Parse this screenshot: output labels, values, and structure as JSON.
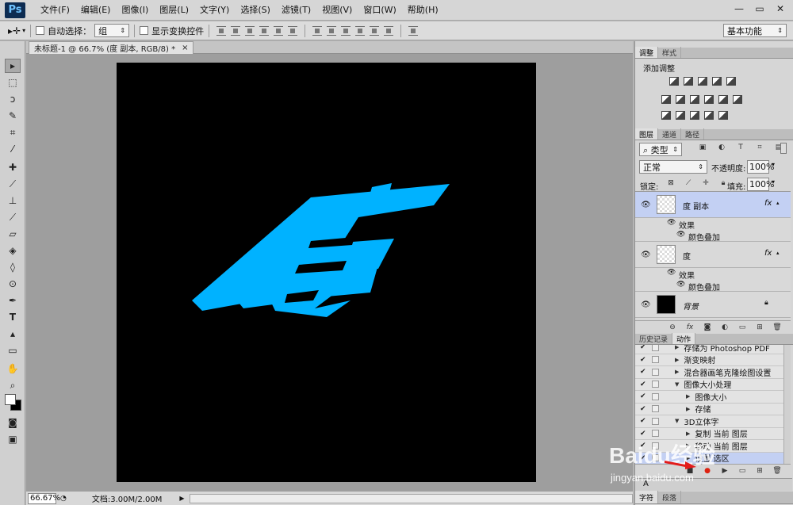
{
  "app": {
    "logo": "Ps"
  },
  "menu": [
    "文件(F)",
    "编辑(E)",
    "图像(I)",
    "图层(L)",
    "文字(Y)",
    "选择(S)",
    "滤镜(T)",
    "视图(V)",
    "窗口(W)",
    "帮助(H)"
  ],
  "window_controls": {
    "minimize": "—",
    "restore": "▭",
    "close": "✕"
  },
  "options": {
    "auto_select_label": "自动选择：",
    "auto_select_value": "组",
    "transform_controls_label": "显示变换控件",
    "workspace_preset": "基本功能"
  },
  "document": {
    "tab_title": "未标题-1 @ 66.7% (度 副本, RGB/8) *",
    "tab_close": "×",
    "canvas_color": "#000000",
    "artwork_text": "度",
    "artwork_color": "#00b2ff"
  },
  "status": {
    "zoom": "66.67%",
    "doc_size": "文档:3.00M/2.00M"
  },
  "panels": {
    "adjust_tabs": [
      "调整",
      "样式"
    ],
    "adjust_title": "添加调整",
    "layers_tabs": [
      "图层",
      "通道",
      "路径"
    ],
    "filter_kind": "类型",
    "blend_mode": "正常",
    "opacity_label": "不透明度:",
    "opacity_value": "100%",
    "lock_label": "锁定:",
    "fill_label": "填充:",
    "fill_value": "100%",
    "layers": [
      {
        "name": "度 副本",
        "fx": "fx",
        "effects_label": "效果",
        "effect": "颜色叠加",
        "selected": true
      },
      {
        "name": "度",
        "fx": "fx",
        "effects_label": "效果",
        "effect": "颜色叠加",
        "selected": false
      },
      {
        "name": "背景",
        "locked": true
      }
    ],
    "actions_tabs": [
      "历史记录",
      "动作"
    ],
    "actions": [
      {
        "label": "存储为 Photoshop PDF",
        "indent": 1
      },
      {
        "label": "渐变映射",
        "indent": 1
      },
      {
        "label": "混合器画笔克隆绘图设置",
        "indent": 1
      },
      {
        "label": "图像大小处理",
        "indent": 1
      },
      {
        "label": "图像大小",
        "indent": 2
      },
      {
        "label": "存储",
        "indent": 2
      },
      {
        "label": "3D立体字",
        "indent": 1
      },
      {
        "label": "复制 当前 图层",
        "indent": 2
      },
      {
        "label": "移动 当前 图层",
        "indent": 2
      },
      {
        "label": "设置 选区",
        "indent": 2
      }
    ],
    "bottom_tabs": [
      "字符",
      "段落"
    ],
    "mini_label": "A"
  },
  "watermark": {
    "brand": "Baidu经验",
    "url": "jingyan.baidu.com"
  }
}
